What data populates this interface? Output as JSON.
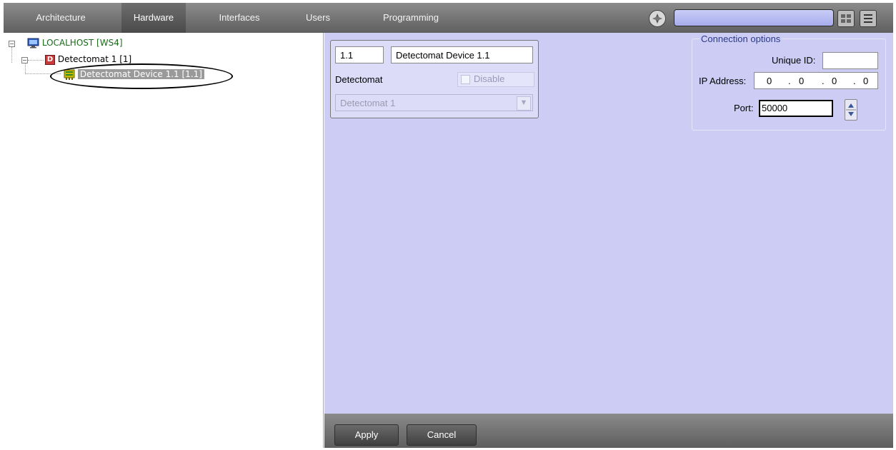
{
  "tabs": [
    {
      "label": "Architecture"
    },
    {
      "label": "Hardware"
    },
    {
      "label": "Interfaces"
    },
    {
      "label": "Users"
    },
    {
      "label": "Programming"
    }
  ],
  "active_tab": "Hardware",
  "tree": {
    "root": {
      "label": "LOCALHOST [WS4]",
      "icon": "computer-icon",
      "color": "#1a6a1a"
    },
    "child": {
      "label": "Detectomat 1 [1]",
      "icon": "detectomat-icon"
    },
    "grandchild": {
      "label": "Detectomat Device 1.1 [1.1]",
      "icon": "device-icon"
    }
  },
  "props": {
    "id_value": "1.1",
    "name_value": "Detectomat Device 1.1",
    "type_label": "Detectomat",
    "disable_label": "Disable",
    "parent_select": "Detectomat 1"
  },
  "connection": {
    "legend": "Connection options",
    "unique_id_label": "Unique ID:",
    "unique_id_value": "",
    "ip_label": "IP Address:",
    "ip_octets": [
      "0",
      "0",
      "0",
      "0"
    ],
    "port_label": "Port:",
    "port_value": "50000"
  },
  "buttons": {
    "apply": "Apply",
    "cancel": "Cancel"
  },
  "colors": {
    "panel_bg": "#ccccf4",
    "accent": "#2b3a8a"
  }
}
